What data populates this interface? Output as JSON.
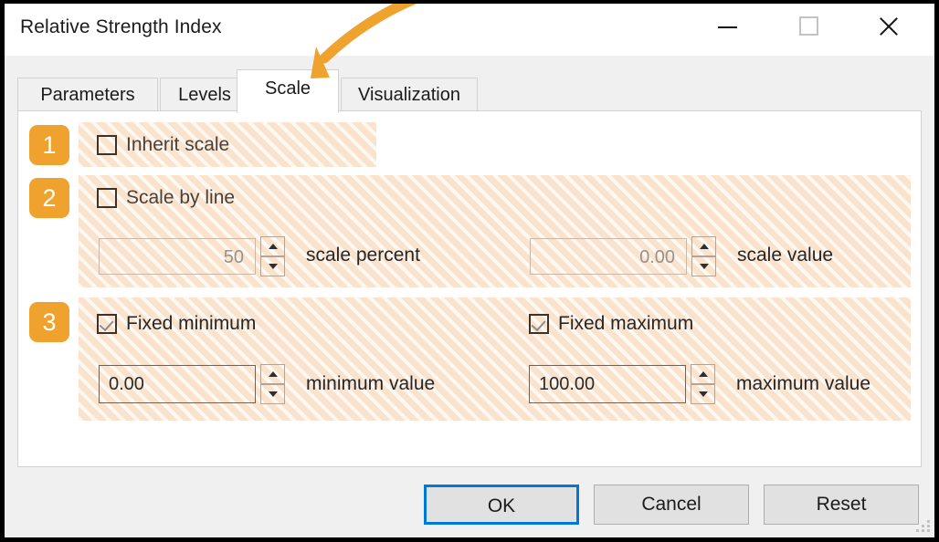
{
  "window": {
    "title": "Relative Strength Index",
    "controls": {
      "minimize": "minimize",
      "maximize": "maximize",
      "close": "close"
    }
  },
  "tabs": [
    {
      "label": "Parameters",
      "active": false
    },
    {
      "label": "Levels",
      "active": false
    },
    {
      "label": "Scale",
      "active": true
    },
    {
      "label": "Visualization",
      "active": false
    }
  ],
  "annotation": {
    "arrow_color": "#efa22e",
    "points_to": "Scale",
    "badges": [
      "1",
      "2",
      "3"
    ]
  },
  "scale_tab": {
    "step1": {
      "badge": "1",
      "checkbox": {
        "label": "Inherit scale",
        "checked": false,
        "enabled": true
      }
    },
    "step2": {
      "badge": "2",
      "checkbox": {
        "label": "Scale by line",
        "checked": false,
        "enabled": true
      },
      "fields": [
        {
          "value": "50",
          "unit_label": "scale percent",
          "enabled": false
        },
        {
          "value": "0.00",
          "unit_label": "scale value",
          "enabled": false
        }
      ]
    },
    "step3": {
      "badge": "3",
      "checkboxes": [
        {
          "label": "Fixed minimum",
          "checked": true
        },
        {
          "label": "Fixed maximum",
          "checked": true
        }
      ],
      "fields": [
        {
          "value": "0.00",
          "unit_label": "minimum value",
          "enabled": true
        },
        {
          "value": "100.00",
          "unit_label": "maximum value",
          "enabled": true
        }
      ]
    }
  },
  "buttons": {
    "ok": "OK",
    "cancel": "Cancel",
    "reset": "Reset"
  },
  "colors": {
    "accent_orange": "#efa22e",
    "highlight_bg": "#fae3cd",
    "focus_blue": "#0078d7",
    "panel_bg": "#f0f0f0"
  }
}
